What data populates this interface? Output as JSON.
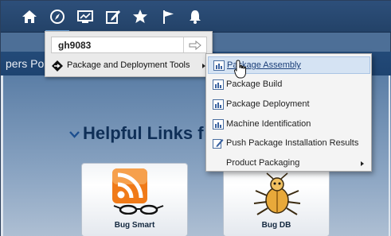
{
  "toolbar": {
    "icons": [
      "home-icon",
      "compass-icon",
      "monitor-icon",
      "edit-icon",
      "star-icon",
      "flag-icon",
      "bell-icon"
    ]
  },
  "host_menu": {
    "input_value": "gh9083",
    "item_label": "Package and Deployment Tools"
  },
  "submenu": {
    "items": [
      {
        "label": "Package Assembly",
        "icon": "chart-icon"
      },
      {
        "label": "Package Build",
        "icon": "chart-icon"
      },
      {
        "label": "Package Deployment",
        "icon": "chart-icon"
      },
      {
        "label": "Machine Identification",
        "icon": "chart-icon"
      },
      {
        "label": "Push Package Installation Results",
        "icon": "edit-icon"
      },
      {
        "label": "Product Packaging",
        "icon": "submenu-arrow"
      }
    ]
  },
  "page": {
    "portal_title": "pers Portal",
    "section_heading": "Helpful Links f",
    "cards": [
      {
        "label": "Bug Smart",
        "icon": "rss-icon"
      },
      {
        "label": "Bug DB",
        "icon": "bug-icon"
      }
    ]
  },
  "colors": {
    "toolbar_bg": "#234268",
    "page_bg": "#5b7ea6",
    "menu_bg": "#f4f4f4",
    "hover_bg": "#d5e3f3",
    "link_text": "#1b3f79"
  }
}
